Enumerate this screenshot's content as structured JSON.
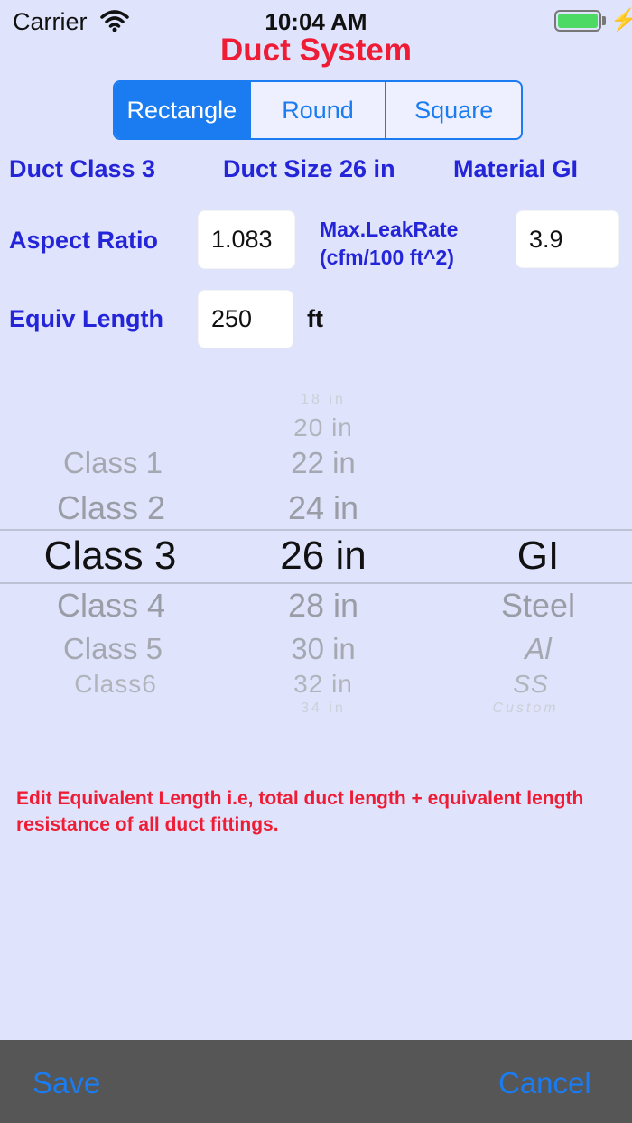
{
  "status_bar": {
    "carrier": "Carrier",
    "time": "10:04 AM",
    "battery_level": 1.0
  },
  "title": "Duct System",
  "segments": [
    {
      "label": "Rectangle",
      "selected": true
    },
    {
      "label": "Round",
      "selected": false
    },
    {
      "label": "Square",
      "selected": false
    }
  ],
  "summary": {
    "duct_class": "Duct Class 3",
    "duct_size": "Duct Size 26 in",
    "material": "Material GI"
  },
  "form": {
    "aspect_ratio_label": "Aspect Ratio",
    "aspect_ratio_value": "1.083",
    "leak_rate_label_line1": "Max.LeakRate",
    "leak_rate_label_line2": "(cfm/100 ft^2)",
    "leak_rate_value": "3.9",
    "equiv_length_label": "Equiv Length",
    "equiv_length_value": "250",
    "equiv_length_unit": "ft"
  },
  "picker": {
    "class_column": [
      "Class 1",
      "Class 2",
      "Class 3",
      "Class 4",
      "Class 5",
      "Class6"
    ],
    "class_selected": "Class 3",
    "size_column": [
      "18 in",
      "20 in",
      "22 in",
      "24 in",
      "26 in",
      "28 in",
      "30 in",
      "32 in",
      "34 in"
    ],
    "size_selected": "26 in",
    "material_column": [
      "GI",
      "Steel",
      "Al",
      "SS",
      "Custom"
    ],
    "material_selected": "GI"
  },
  "note": "Edit Equivalent Length i.e, total duct length + equivalent length resistance of all duct fittings.",
  "toolbar": {
    "save_label": "Save",
    "cancel_label": "Cancel"
  },
  "colors": {
    "background": "#dfe3fb",
    "accent": "#1a7cf0",
    "title_red": "#ee1c35",
    "label_blue": "#2424d8",
    "toolbar": "#565656"
  }
}
